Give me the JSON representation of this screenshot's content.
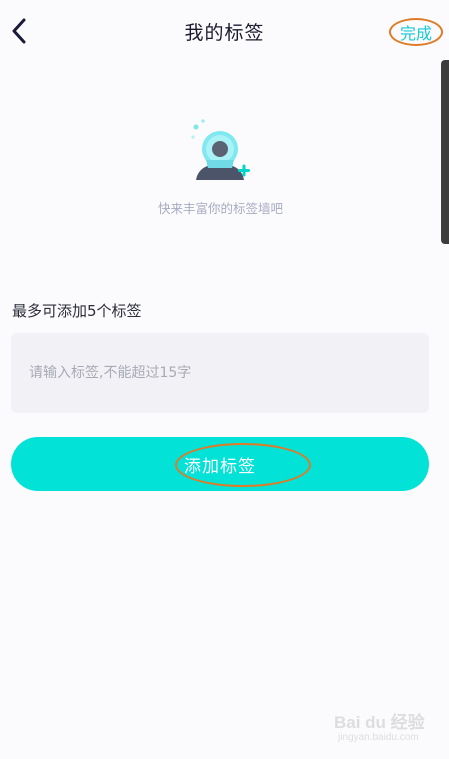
{
  "header": {
    "title": "我的标签",
    "done_label": "完成",
    "back_icon": "chevron-left-icon"
  },
  "empty_state": {
    "illustration_icon": "add-tag-avatar-icon",
    "message": "快来丰富你的标签墙吧"
  },
  "form": {
    "limit_label": "最多可添加5个标签",
    "input_placeholder": "请输入标签,不能超过15字",
    "input_value": "",
    "add_button_label": "添加标签"
  },
  "watermark": {
    "text": "Bai du 经验",
    "subtext": "jingyan.baidu.com"
  },
  "colors": {
    "accent": "#02e2d6",
    "done_text": "#19c9d4",
    "highlight_ring": "#e07a26",
    "background": "#fbfbfd"
  }
}
